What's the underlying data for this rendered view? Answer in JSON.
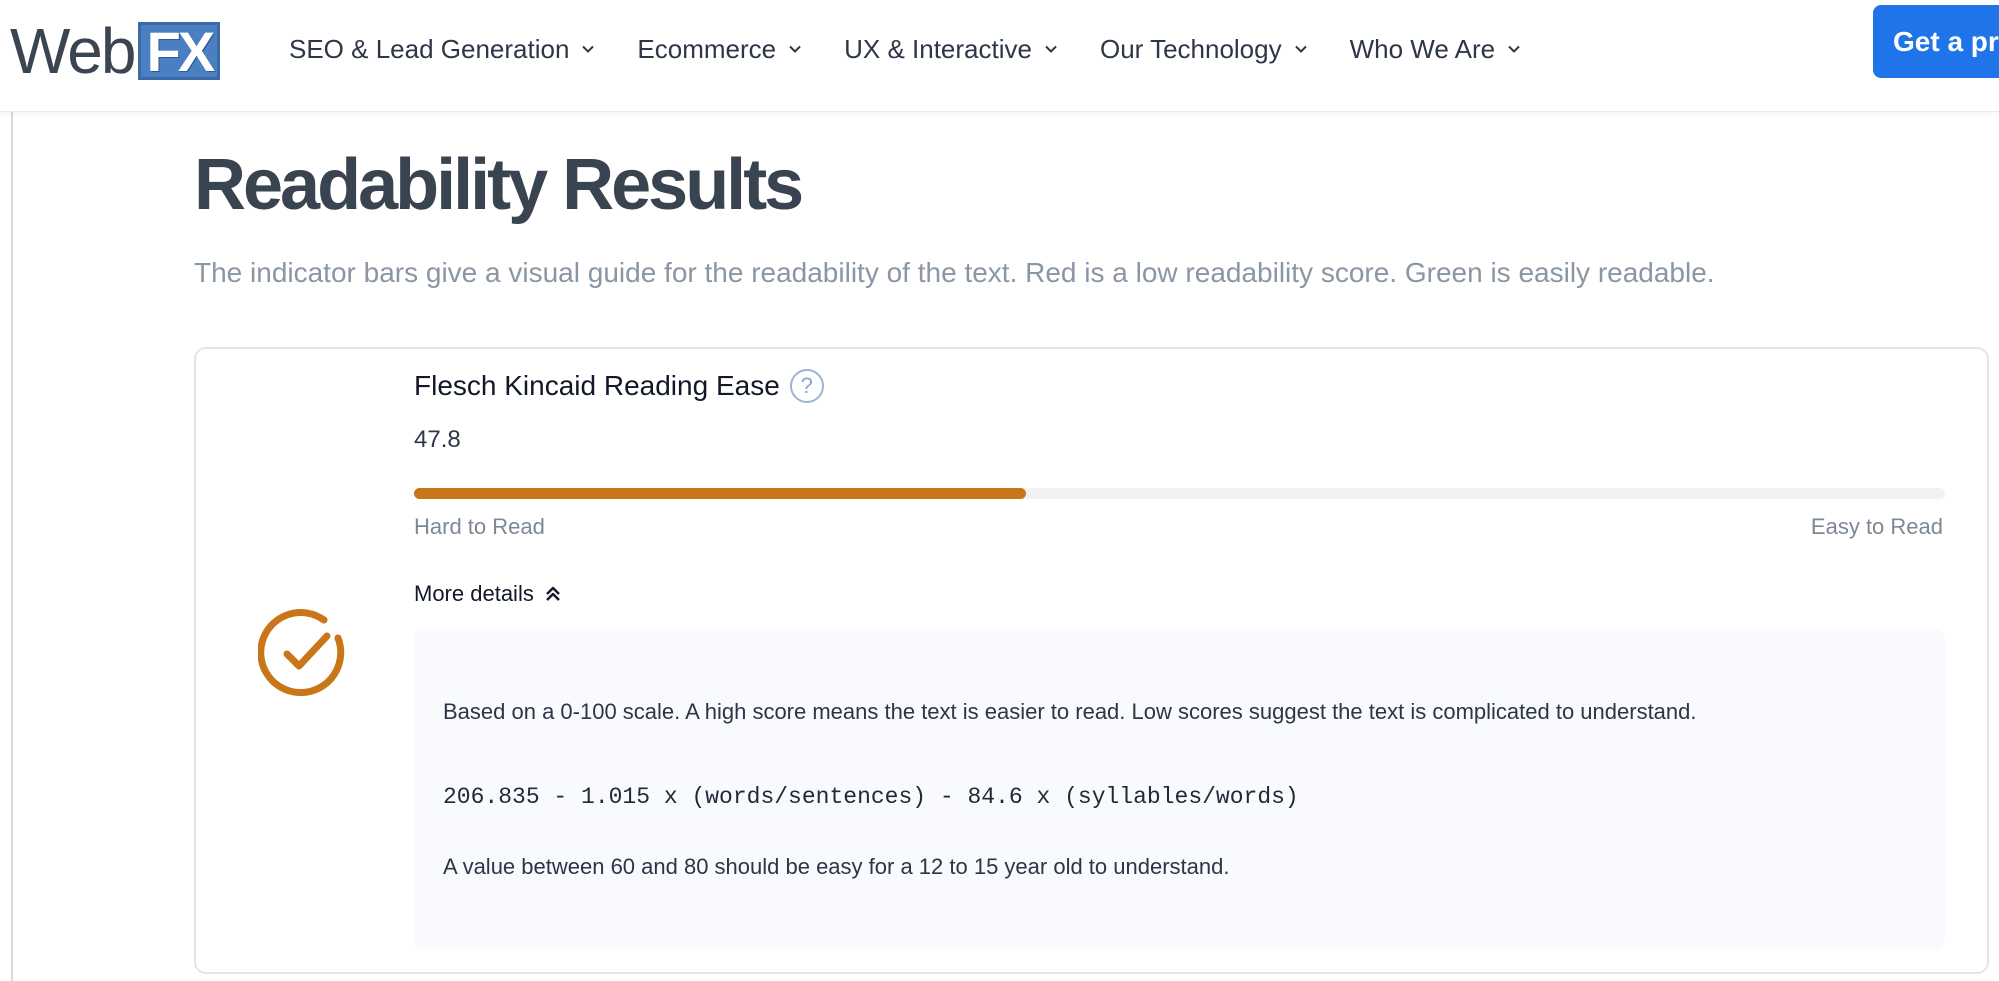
{
  "header": {
    "logo_text": "Web",
    "logo_badge": "FX",
    "nav": [
      {
        "label": "SEO & Lead Generation"
      },
      {
        "label": "Ecommerce"
      },
      {
        "label": "UX & Interactive"
      },
      {
        "label": "Our Technology"
      },
      {
        "label": "Who We Are"
      }
    ],
    "cta_label": "Get a pr"
  },
  "main": {
    "title": "Readability Results",
    "subtitle": "The indicator bars give a visual guide for the readability of the text. Red is a low readability score. Green is easily readable."
  },
  "metric": {
    "name": "Flesch Kincaid Reading Ease",
    "help_glyph": "?",
    "value": "47.8",
    "bar_fraction": 0.4,
    "bar_color": "#c87618",
    "icon_color": "#c87618",
    "scale_low": "Hard to Read",
    "scale_high": "Easy to Read",
    "toggle_label": "More details",
    "details": {
      "description": "Based on a 0-100 scale. A high score means the text is easier to read. Low scores suggest the text is complicated to understand.",
      "formula": "206.835 - 1.015 x (words/sentences) - 84.6 x (syllables/words)",
      "note": "A value between 60 and 80 should be easy for a 12 to 15 year old to understand."
    }
  },
  "colors": {
    "cta": "#1e74e8",
    "title": "#3a4350",
    "subtitle": "#8a96a3"
  }
}
